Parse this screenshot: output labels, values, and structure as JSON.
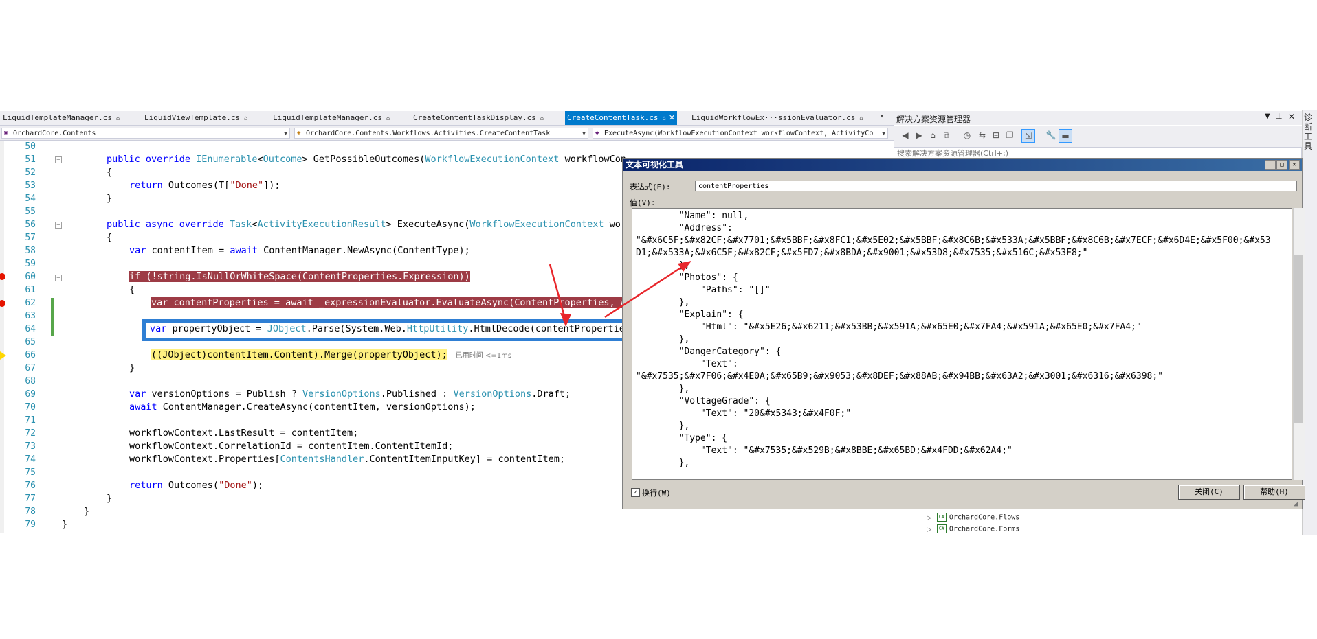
{
  "tabs": [
    {
      "label": "LiquidTemplateManager.cs",
      "active": false
    },
    {
      "label": "LiquidViewTemplate.cs",
      "active": false
    },
    {
      "label": "LiquidTemplateManager.cs",
      "active": false
    },
    {
      "label": "CreateContentTaskDisplay.cs",
      "active": false
    },
    {
      "label": "CreateContentTask.cs",
      "active": true
    },
    {
      "label": "LiquidWorkflowEx···ssionEvaluator.cs",
      "active": false
    }
  ],
  "pin_glyph": "⌂",
  "close_glyph": "✕",
  "navbar": {
    "project": "OrchardCore.Contents",
    "class": "OrchardCore.Contents.Workflows.Activities.CreateContentTask",
    "member": "ExecuteAsync(WorkflowExecutionContext workflowContext, ActivityCo"
  },
  "code_lines": [
    {
      "n": "50"
    },
    {
      "n": "51"
    },
    {
      "n": "52"
    },
    {
      "n": "53"
    },
    {
      "n": "54"
    },
    {
      "n": "55"
    },
    {
      "n": "56"
    },
    {
      "n": "57"
    },
    {
      "n": "58"
    },
    {
      "n": "59"
    },
    {
      "n": "60"
    },
    {
      "n": "61"
    },
    {
      "n": "62"
    },
    {
      "n": "63"
    },
    {
      "n": "64"
    },
    {
      "n": "65"
    },
    {
      "n": "66"
    },
    {
      "n": "67"
    },
    {
      "n": "68"
    },
    {
      "n": "69"
    },
    {
      "n": "70"
    },
    {
      "n": "71"
    },
    {
      "n": "72"
    },
    {
      "n": "73"
    },
    {
      "n": "74"
    },
    {
      "n": "75"
    },
    {
      "n": "76"
    },
    {
      "n": "77"
    },
    {
      "n": "78"
    },
    {
      "n": "79"
    }
  ],
  "code": {
    "l51": {
      "a": "public",
      "b": "override",
      "c": "IEnumerable",
      "d": "<",
      "e": "Outcome",
      "f": "> GetPossibleOutcomes(",
      "g": "WorkflowExecutionContext",
      "h": " workflowCon"
    },
    "l52": "{",
    "l53": {
      "a": "return",
      "b": " Outcomes(T[",
      "c": "\"Done\"",
      "d": "]);"
    },
    "l54": "}",
    "l56": {
      "a": "public",
      "b": "async",
      "c": "override",
      "d": "Task",
      "e": "<",
      "f": "ActivityExecutionResult",
      "g": "> ExecuteAsync(",
      "h": "WorkflowExecutionContext",
      "i": " wor"
    },
    "l57": "{",
    "l58": {
      "a": "var",
      "b": " contentItem = ",
      "c": "await",
      "d": " ContentManager.NewAsync(ContentType);"
    },
    "l60": "if (!string.IsNullOrWhiteSpace(ContentProperties.Expression))",
    "l61": "{",
    "l62": "var contentProperties = await _expressionEvaluator.EvaluateAsync(ContentProperties, w",
    "l64": {
      "a": "var",
      "b": " propertyObject = ",
      "c": "JObject",
      "d": ".Parse(System.Web.",
      "e": "HttpUtility",
      "f": ".HtmlDecode(contentPropertie"
    },
    "l66": "((JObject)contentItem.Content).Merge(propertyObject);",
    "l66_elapsed": "已用时间 <=1ms",
    "l67": "}",
    "l69": {
      "a": "var",
      "b": " versionOptions = Publish ? ",
      "c": "VersionOptions",
      "d": ".Published : ",
      "e": "VersionOptions",
      "f": ".Draft;"
    },
    "l70": {
      "a": "await",
      "b": " ContentManager.CreateAsync(contentItem, versionOptions);"
    },
    "l72": "workflowContext.LastResult = contentItem;",
    "l73": "workflowContext.CorrelationId = contentItem.ContentItemId;",
    "l74": {
      "a": "workflowContext.Properties[",
      "b": "ContentsHandler",
      "c": ".ContentItemInputKey] = contentItem;"
    },
    "l76": {
      "a": "return",
      "b": " Outcomes(",
      "c": "\"Done\"",
      "d": ");"
    },
    "l77": "}",
    "l78": "}",
    "l79": "}"
  },
  "solution_explorer": {
    "title": "解决方案资源管理器",
    "search_placeholder": "搜索解决方案资源管理器(Ctrl+;)",
    "items": [
      "OrchardCore.Flows",
      "OrchardCore.Forms"
    ],
    "side_label": "诊断工具"
  },
  "dialog": {
    "title": "文本可视化工具",
    "expr_label": "表达式(E):",
    "expr_value": "contentProperties",
    "value_label": "值(V):",
    "value_text": "        \"Name\": null,\n        \"Address\":\n\"&#x6C5F;&#x82CF;&#x7701;&#x5BBF;&#x8FC1;&#x5E02;&#x5BBF;&#x8C6B;&#x533A;&#x5BBF;&#x8C6B;&#x7ECF;&#x6D4E;&#x5F00;&#x53\nD1;&#x533A;&#x6C5F;&#x82CF;&#x5FD7;&#x8BDA;&#x9001;&#x53D8;&#x7535;&#x516C;&#x53F8;\"\n        },\n        \"Photos\": {\n            \"Paths\": \"[]\"\n        },\n        \"Explain\": {\n            \"Html\": \"&#x5E26;&#x6211;&#x53BB;&#x591A;&#x65E0;&#x7FA4;&#x591A;&#x65E0;&#x7FA4;\"\n        },\n        \"DangerCategory\": {\n            \"Text\":\n\"&#x7535;&#x7F06;&#x4E0A;&#x65B9;&#x9053;&#x8DEF;&#x88AB;&#x94BB;&#x63A2;&#x3001;&#x6316;&#x6398;\"\n        },\n        \"VoltageGrade\": {\n            \"Text\": \"20&#x5343;&#x4F0F;\"\n        },\n        \"Type\": {\n            \"Text\": \"&#x7535;&#x529B;&#x8BBE;&#x65BD;&#x4FDD;&#x62A4;\"\n        },",
    "wrap_label": "换行(W)",
    "close_button": "关闭(C)",
    "help_button": "帮助(H)"
  },
  "colors": {
    "keyword": "#0000ff",
    "type": "#2b91af",
    "string": "#a31515",
    "breakpoint_highlight": "#9d3b45",
    "current_line": "#fff181",
    "active_tab": "#007acc",
    "annotation_box": "#2f7fd4",
    "annotation_arrow": "#e8262b"
  }
}
